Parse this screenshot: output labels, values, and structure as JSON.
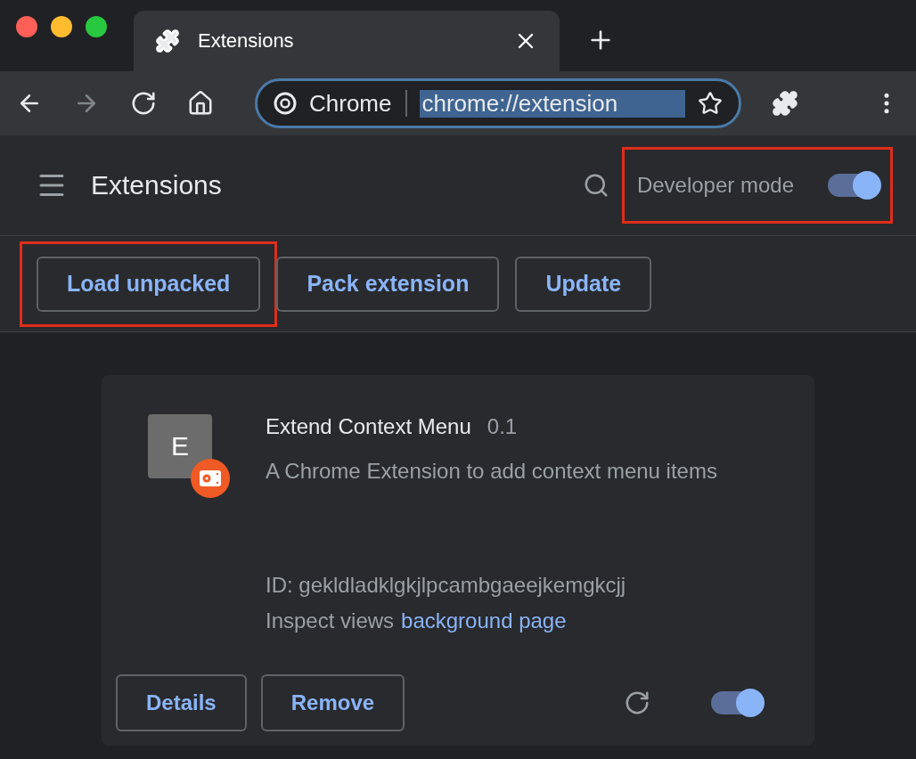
{
  "tab": {
    "title": "Extensions"
  },
  "nav": [
    {
      "kind": "back",
      "disabled": false
    },
    {
      "kind": "forward",
      "disabled": true
    },
    {
      "kind": "reload",
      "disabled": false
    },
    {
      "kind": "home",
      "disabled": false
    }
  ],
  "omnibox": {
    "site_label": "Chrome",
    "url": "chrome://extension",
    "url_selected": true
  },
  "header": {
    "title": "Extensions",
    "developer_mode": {
      "label": "Developer mode",
      "on": true,
      "highlighted": true
    }
  },
  "actions": [
    {
      "label": "Load unpacked",
      "highlighted": true
    },
    {
      "label": "Pack extension",
      "highlighted": false
    },
    {
      "label": "Update",
      "highlighted": false
    }
  ],
  "extensions": [
    {
      "icon_letter": "E",
      "name": "Extend Context Menu",
      "version": "0.1",
      "description": "A Chrome Extension to add context menu items",
      "id": "ID: gekldladklgkjlpcambgaeejkemgkcjj",
      "inspect_label": "Inspect views",
      "inspect_link": "background page",
      "buttons": [
        "Details",
        "Remove"
      ],
      "enabled": true
    }
  ]
}
